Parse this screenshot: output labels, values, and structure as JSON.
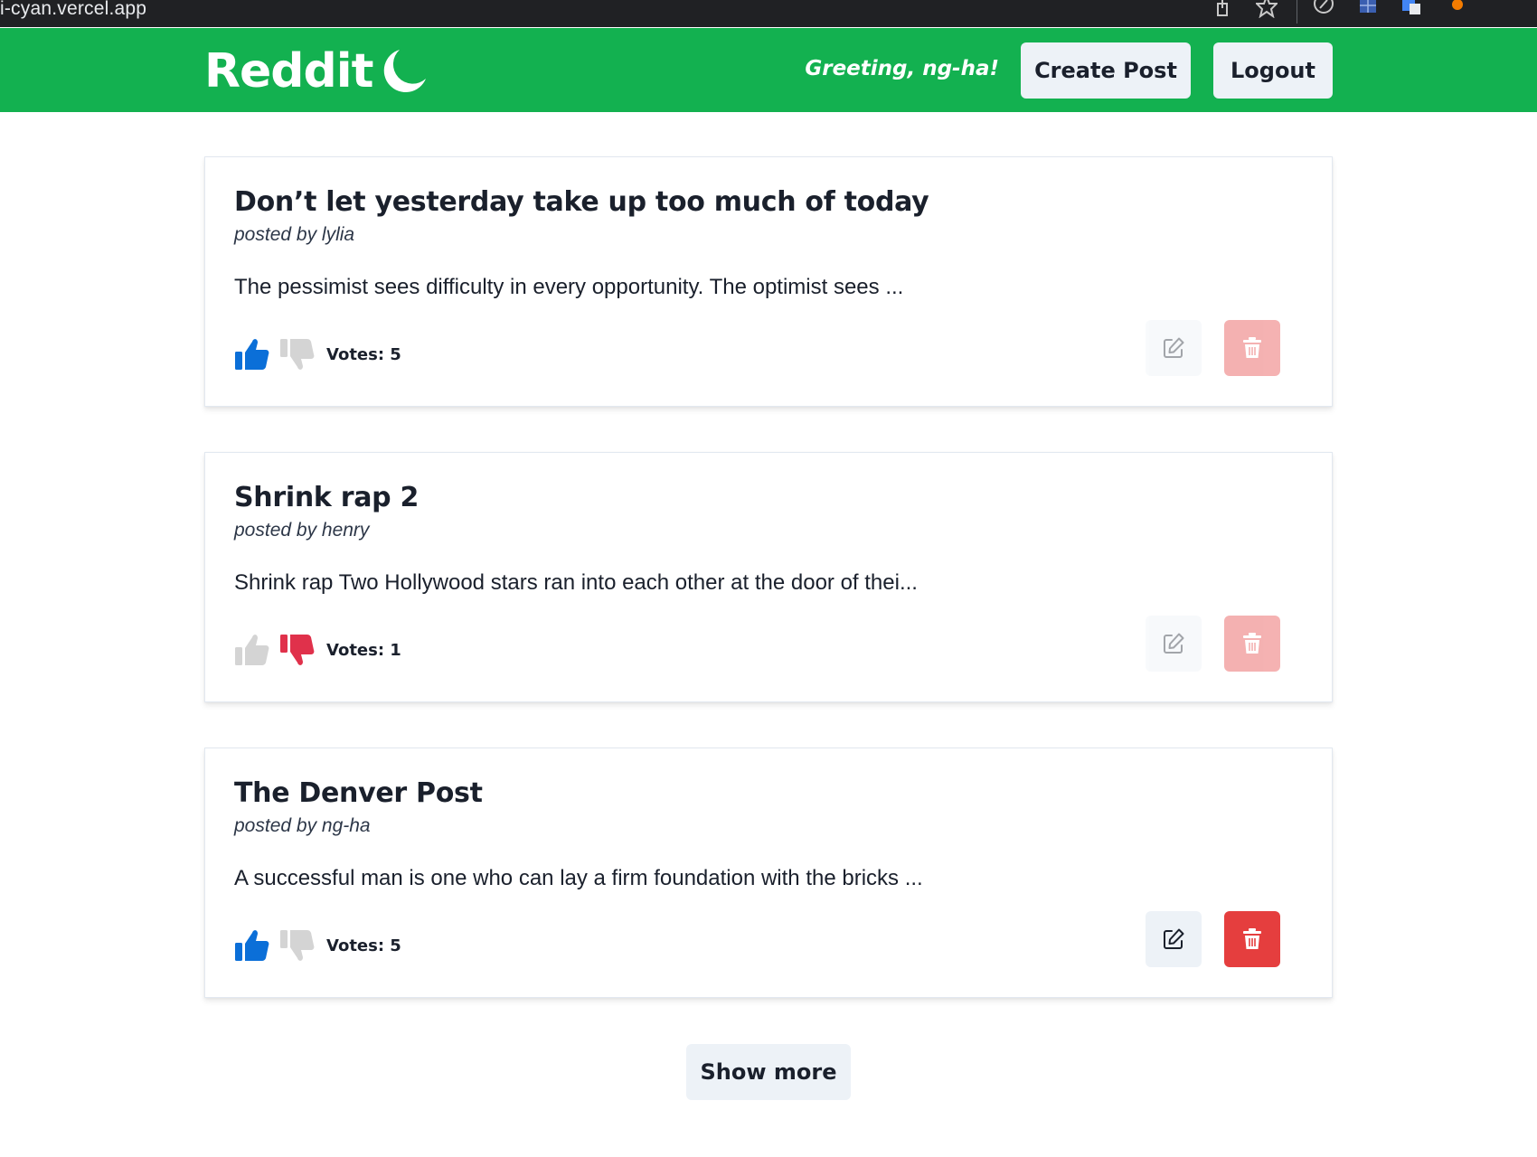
{
  "browser": {
    "url": "i-cyan.vercel.app",
    "icons": [
      "share-icon",
      "star-icon",
      "compass-extension-icon",
      "grid-extension-icon",
      "translate-extension-icon",
      "orange-extension-icon"
    ]
  },
  "header": {
    "brand": "Reddit",
    "brand_icon": "moon-icon",
    "greeting": "Greeting, ng-ha!",
    "create_label": "Create Post",
    "logout_label": "Logout",
    "color": "#13b150"
  },
  "posts": [
    {
      "title": "Don’t let yesterday take up too much of today",
      "author": "posted by lylia",
      "excerpt": "The pessimist sees difficulty in every opportunity. The optimist sees ...",
      "votes": "Votes: 5",
      "vote_state": "up",
      "actions_enabled": false
    },
    {
      "title": "Shrink rap 2",
      "author": "posted by henry",
      "excerpt": "Shrink rap Two Hollywood stars ran into each other at the door of thei...",
      "votes": "Votes: 1",
      "vote_state": "down",
      "actions_enabled": false
    },
    {
      "title": "The Denver Post",
      "author": "posted by ng-ha",
      "excerpt": "A successful man is one who can lay a firm foundation with the bricks ...",
      "votes": "Votes: 5",
      "vote_state": "up",
      "actions_enabled": true
    }
  ],
  "show_more_label": "Show more",
  "colors": {
    "upvote_active": "#0b6fd8",
    "downvote_active": "#e0314b",
    "vote_inactive": "#d4d4d4",
    "delete": "#e53e3e",
    "button_bg": "#edf2f7"
  }
}
